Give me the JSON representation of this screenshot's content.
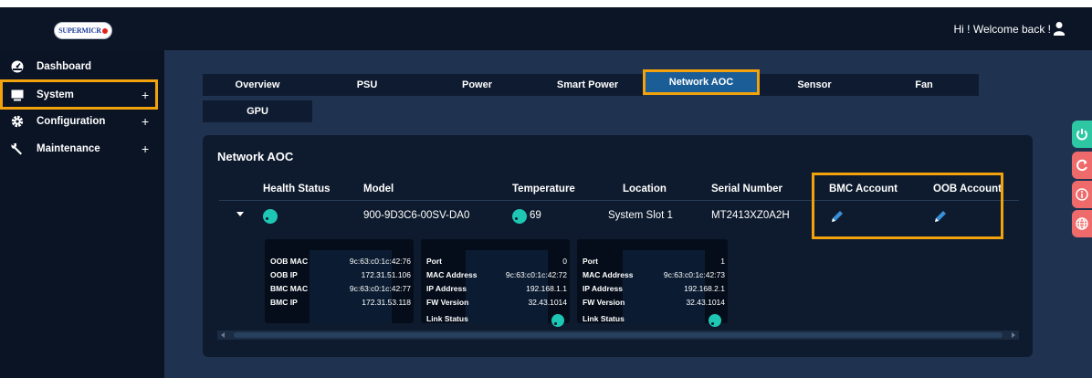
{
  "header": {
    "logo_text": "SUPERMICR",
    "welcome": "Hi ! Welcome back !"
  },
  "sidebar": {
    "items": [
      {
        "label": "Dashboard",
        "icon": "dashboard-icon",
        "expandable": false
      },
      {
        "label": "System",
        "icon": "monitor-icon",
        "expandable": true,
        "plus": "+"
      },
      {
        "label": "Configuration",
        "icon": "gear-icon",
        "expandable": true,
        "plus": "+"
      },
      {
        "label": "Maintenance",
        "icon": "wrench-icon",
        "expandable": true,
        "plus": "+"
      }
    ]
  },
  "tabs": [
    "Overview",
    "PSU",
    "Power",
    "Smart Power",
    "Network AOC",
    "Sensor",
    "Fan",
    "GPU"
  ],
  "active_tab": "Network AOC",
  "panel": {
    "title": "Network AOC",
    "columns": [
      "Health Status",
      "Model",
      "Temperature",
      "Location",
      "Serial Number",
      "BMC Account",
      "OOB Account"
    ],
    "row": {
      "model": "900-9D3C6-00SV-DA0",
      "temperature": "69",
      "location": "System Slot 1",
      "serial": "MT2413XZ0A2H"
    },
    "detail1": {
      "labels": [
        "OOB MAC",
        "OOB IP",
        "BMC MAC",
        "BMC IP"
      ],
      "values": [
        "9c:63:c0:1c:42:76",
        "172.31.51.106",
        "9c:63:c0:1c:42:77",
        "172.31.53.118"
      ]
    },
    "detail2": {
      "labels": [
        "Port",
        "MAC Address",
        "IP Address",
        "FW Version",
        "Link Status"
      ],
      "values": [
        "0",
        "9c:63:c0:1c:42:72",
        "192.168.1.1",
        "32.43.1014"
      ]
    },
    "detail3": {
      "labels": [
        "Port",
        "MAC Address",
        "IP Address",
        "FW Version",
        "Link Status"
      ],
      "values": [
        "1",
        "9c:63:c0:1c:42:73",
        "192.168.2.1",
        "32.43.1014"
      ]
    }
  },
  "side_buttons": [
    {
      "icon": "power-icon",
      "color": "#2ec7a4"
    },
    {
      "icon": "refresh-icon",
      "color": "#ef6a6a"
    },
    {
      "icon": "info-icon",
      "color": "#ef6a6a"
    },
    {
      "icon": "globe-icon",
      "color": "#ef6a6a"
    }
  ],
  "colors": {
    "highlight": "#f2a20c",
    "active_tab": "#1b5e97",
    "status_led": "#1ec7b3",
    "edit_icon": "#3a8fd9"
  }
}
